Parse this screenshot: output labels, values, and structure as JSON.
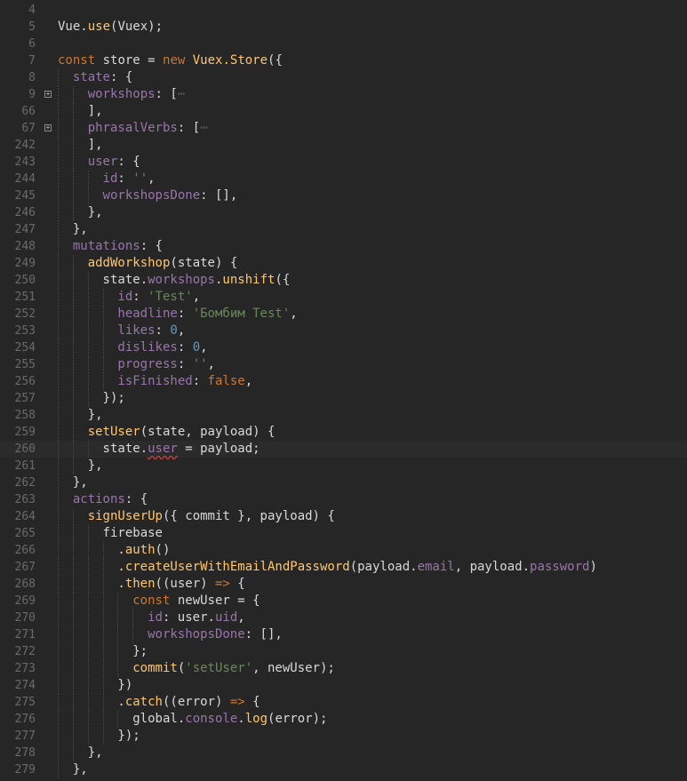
{
  "editor": {
    "gutter_label": "line numbers",
    "lines": [
      {
        "n": "4",
        "indent": 0,
        "tokens": []
      },
      {
        "n": "5",
        "indent": 0,
        "tokens": [
          [
            "def",
            "Vue."
          ],
          [
            "fn",
            "use"
          ],
          [
            "def",
            "(Vuex);"
          ]
        ]
      },
      {
        "n": "6",
        "indent": 0,
        "tokens": []
      },
      {
        "n": "7",
        "indent": 0,
        "tokens": [
          [
            "kw",
            "const"
          ],
          [
            "def",
            " store = "
          ],
          [
            "kw",
            "new"
          ],
          [
            "def",
            " "
          ],
          [
            "cls",
            "Vuex.Store"
          ],
          [
            "def",
            "({"
          ]
        ]
      },
      {
        "n": "8",
        "indent": 1,
        "tokens": [
          [
            "prop",
            "state"
          ],
          [
            "def",
            ": {"
          ]
        ]
      },
      {
        "n": "9",
        "indent": 2,
        "fold": "+",
        "tokens": [
          [
            "prop",
            "workshops"
          ],
          [
            "def",
            ": ["
          ],
          [
            "dots",
            "⋯"
          ]
        ]
      },
      {
        "n": "66",
        "indent": 2,
        "tokens": [
          [
            "def",
            "],"
          ]
        ]
      },
      {
        "n": "67",
        "indent": 2,
        "fold": "+",
        "tokens": [
          [
            "prop",
            "phrasalVerbs"
          ],
          [
            "def",
            ": ["
          ],
          [
            "dots",
            "⋯"
          ]
        ]
      },
      {
        "n": "242",
        "indent": 2,
        "tokens": [
          [
            "def",
            "],"
          ]
        ]
      },
      {
        "n": "243",
        "indent": 2,
        "tokens": [
          [
            "prop",
            "user"
          ],
          [
            "def",
            ": {"
          ]
        ]
      },
      {
        "n": "244",
        "indent": 3,
        "tokens": [
          [
            "prop",
            "id"
          ],
          [
            "def",
            ": "
          ],
          [
            "str",
            "''"
          ],
          [
            "def",
            ","
          ]
        ]
      },
      {
        "n": "245",
        "indent": 3,
        "tokens": [
          [
            "prop",
            "workshopsDone"
          ],
          [
            "def",
            ": [],"
          ]
        ]
      },
      {
        "n": "246",
        "indent": 2,
        "tokens": [
          [
            "def",
            "},"
          ]
        ]
      },
      {
        "n": "247",
        "indent": 1,
        "tokens": [
          [
            "def",
            "},"
          ]
        ]
      },
      {
        "n": "248",
        "indent": 1,
        "tokens": [
          [
            "prop",
            "mutations"
          ],
          [
            "def",
            ": {"
          ]
        ]
      },
      {
        "n": "249",
        "indent": 2,
        "tokens": [
          [
            "fn",
            "addWorkshop"
          ],
          [
            "def",
            "(state) {"
          ]
        ]
      },
      {
        "n": "250",
        "indent": 3,
        "tokens": [
          [
            "def",
            "state."
          ],
          [
            "prop",
            "workshops"
          ],
          [
            "def",
            "."
          ],
          [
            "fn",
            "unshift"
          ],
          [
            "def",
            "({"
          ]
        ]
      },
      {
        "n": "251",
        "indent": 4,
        "tokens": [
          [
            "prop",
            "id"
          ],
          [
            "def",
            ": "
          ],
          [
            "str",
            "'Test'"
          ],
          [
            "def",
            ","
          ]
        ]
      },
      {
        "n": "252",
        "indent": 4,
        "tokens": [
          [
            "prop",
            "headline"
          ],
          [
            "def",
            ": "
          ],
          [
            "str",
            "'Бомбим Test'"
          ],
          [
            "def",
            ","
          ]
        ]
      },
      {
        "n": "253",
        "indent": 4,
        "tokens": [
          [
            "prop",
            "likes"
          ],
          [
            "def",
            ": "
          ],
          [
            "num",
            "0"
          ],
          [
            "def",
            ","
          ]
        ]
      },
      {
        "n": "254",
        "indent": 4,
        "tokens": [
          [
            "prop",
            "dislikes"
          ],
          [
            "def",
            ": "
          ],
          [
            "num",
            "0"
          ],
          [
            "def",
            ","
          ]
        ]
      },
      {
        "n": "255",
        "indent": 4,
        "tokens": [
          [
            "prop",
            "progress"
          ],
          [
            "def",
            ": "
          ],
          [
            "str",
            "''"
          ],
          [
            "def",
            ","
          ]
        ]
      },
      {
        "n": "256",
        "indent": 4,
        "tokens": [
          [
            "prop",
            "isFinished"
          ],
          [
            "def",
            ": "
          ],
          [
            "kw",
            "false"
          ],
          [
            "def",
            ","
          ]
        ]
      },
      {
        "n": "257",
        "indent": 3,
        "tokens": [
          [
            "def",
            "});"
          ]
        ]
      },
      {
        "n": "258",
        "indent": 2,
        "tokens": [
          [
            "def",
            "},"
          ]
        ]
      },
      {
        "n": "259",
        "indent": 2,
        "tokens": [
          [
            "fn",
            "setUser"
          ],
          [
            "def",
            "(state, payload) {"
          ]
        ]
      },
      {
        "n": "260",
        "indent": 3,
        "current": true,
        "tokens": [
          [
            "def",
            "state."
          ],
          [
            "err",
            "user"
          ],
          [
            "def",
            " = payload;"
          ]
        ]
      },
      {
        "n": "261",
        "indent": 2,
        "tokens": [
          [
            "def",
            "},"
          ]
        ]
      },
      {
        "n": "262",
        "indent": 1,
        "tokens": [
          [
            "def",
            "},"
          ]
        ]
      },
      {
        "n": "263",
        "indent": 1,
        "tokens": [
          [
            "prop",
            "actions"
          ],
          [
            "def",
            ": {"
          ]
        ]
      },
      {
        "n": "264",
        "indent": 2,
        "tokens": [
          [
            "fn",
            "signUserUp"
          ],
          [
            "def",
            "({ commit }, payload) {"
          ]
        ]
      },
      {
        "n": "265",
        "indent": 3,
        "tokens": [
          [
            "def",
            "firebase"
          ]
        ]
      },
      {
        "n": "266",
        "indent": 4,
        "tokens": [
          [
            "def",
            "."
          ],
          [
            "fn",
            "auth"
          ],
          [
            "def",
            "()"
          ]
        ]
      },
      {
        "n": "267",
        "indent": 4,
        "tokens": [
          [
            "def",
            "."
          ],
          [
            "fn",
            "createUserWithEmailAndPassword"
          ],
          [
            "def",
            "(payload."
          ],
          [
            "prop",
            "email"
          ],
          [
            "def",
            ", payload."
          ],
          [
            "prop",
            "password"
          ],
          [
            "def",
            ")"
          ]
        ]
      },
      {
        "n": "268",
        "indent": 4,
        "tokens": [
          [
            "def",
            "."
          ],
          [
            "fn",
            "then"
          ],
          [
            "def",
            "((user) "
          ],
          [
            "kw",
            "=>"
          ],
          [
            "def",
            " {"
          ]
        ]
      },
      {
        "n": "269",
        "indent": 5,
        "tokens": [
          [
            "kw",
            "const"
          ],
          [
            "def",
            " newUser = {"
          ]
        ]
      },
      {
        "n": "270",
        "indent": 6,
        "tokens": [
          [
            "prop",
            "id"
          ],
          [
            "def",
            ": user."
          ],
          [
            "prop",
            "uid"
          ],
          [
            "def",
            ","
          ]
        ]
      },
      {
        "n": "271",
        "indent": 6,
        "tokens": [
          [
            "prop",
            "workshopsDone"
          ],
          [
            "def",
            ": [],"
          ]
        ]
      },
      {
        "n": "272",
        "indent": 5,
        "tokens": [
          [
            "def",
            "};"
          ]
        ]
      },
      {
        "n": "273",
        "indent": 5,
        "tokens": [
          [
            "fn",
            "commit"
          ],
          [
            "def",
            "("
          ],
          [
            "str",
            "'setUser'"
          ],
          [
            "def",
            ", newUser);"
          ]
        ]
      },
      {
        "n": "274",
        "indent": 4,
        "tokens": [
          [
            "def",
            "})"
          ]
        ]
      },
      {
        "n": "275",
        "indent": 4,
        "tokens": [
          [
            "def",
            "."
          ],
          [
            "fn",
            "catch"
          ],
          [
            "def",
            "((error) "
          ],
          [
            "kw",
            "=>"
          ],
          [
            "def",
            " {"
          ]
        ]
      },
      {
        "n": "276",
        "indent": 5,
        "tokens": [
          [
            "def",
            "global."
          ],
          [
            "prop",
            "console"
          ],
          [
            "def",
            "."
          ],
          [
            "fn",
            "log"
          ],
          [
            "def",
            "(error);"
          ]
        ]
      },
      {
        "n": "277",
        "indent": 4,
        "tokens": [
          [
            "def",
            "});"
          ]
        ]
      },
      {
        "n": "278",
        "indent": 2,
        "tokens": [
          [
            "def",
            "},"
          ]
        ]
      },
      {
        "n": "279",
        "indent": 1,
        "tokens": [
          [
            "def",
            "},"
          ]
        ]
      }
    ]
  },
  "colors": {
    "background": "#262626",
    "keyword": "#cc7832",
    "function": "#ffc66d",
    "property": "#9876aa",
    "string": "#6a8759",
    "number": "#6897bb",
    "text": "#d9d9d9",
    "line_number": "#6a6a6a",
    "error_underline": "#bc3f3c"
  }
}
